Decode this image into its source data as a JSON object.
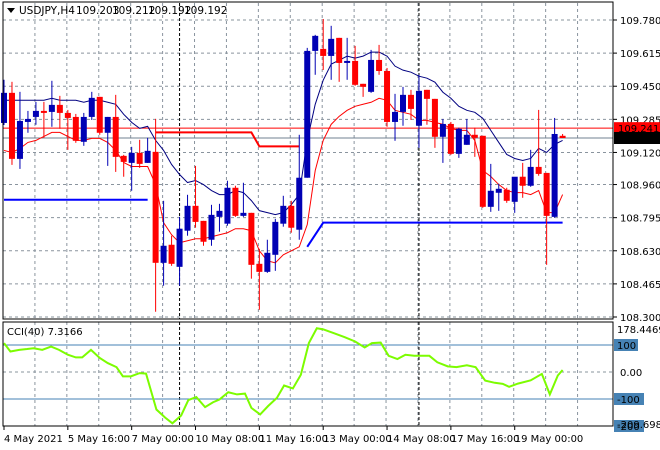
{
  "chart_data": {
    "type": "candlestick",
    "title": {
      "symbol": "USDJPY,H4",
      "open": "109.203",
      "high": "109.212",
      "low": "109.192",
      "close": "109.192"
    },
    "price_axis": {
      "ticks": [
        "109.780",
        "109.615",
        "109.450",
        "109.285",
        "109.120",
        "108.960",
        "108.795",
        "108.630",
        "108.465",
        "108.300"
      ],
      "range": [
        108.3,
        109.78
      ]
    },
    "price_tags": {
      "line_level": "109.241",
      "bid": "109.192"
    },
    "time_labels": [
      "4 May 2021",
      "5 May 16:00",
      "7 May 00:00",
      "10 May 08:00",
      "11 May 16:00",
      "13 May 00:00",
      "14 May 08:00",
      "17 May 16:00",
      "19 May 00:00"
    ],
    "time_label_every_bars": 8,
    "week_separator_bars": [
      22,
      52
    ],
    "candles_ohlc": [
      [
        109.267,
        109.482,
        109.257,
        109.417
      ],
      [
        109.417,
        109.472,
        109.058,
        109.088
      ],
      [
        109.088,
        109.422,
        109.038,
        109.277
      ],
      [
        109.272,
        109.327,
        109.218,
        109.287
      ],
      [
        109.297,
        109.372,
        109.258,
        109.327
      ],
      [
        109.327,
        109.372,
        109.193,
        109.317
      ],
      [
        109.322,
        109.477,
        109.248,
        109.357
      ],
      [
        109.357,
        109.402,
        109.238,
        109.317
      ],
      [
        109.317,
        109.332,
        109.133,
        109.292
      ],
      [
        109.297,
        109.312,
        109.168,
        109.178
      ],
      [
        109.173,
        109.317,
        109.153,
        109.297
      ],
      [
        109.297,
        109.422,
        109.282,
        109.392
      ],
      [
        109.397,
        109.397,
        109.208,
        109.218
      ],
      [
        109.218,
        109.297,
        109.053,
        109.297
      ],
      [
        109.297,
        109.407,
        109.023,
        109.098
      ],
      [
        109.103,
        109.108,
        108.999,
        109.073
      ],
      [
        109.068,
        109.148,
        108.929,
        109.118
      ],
      [
        109.118,
        109.183,
        109.043,
        109.063
      ],
      [
        109.068,
        109.193,
        109.068,
        109.128
      ],
      [
        109.123,
        109.287,
        108.326,
        108.57
      ],
      [
        108.57,
        108.879,
        108.456,
        108.655
      ],
      [
        108.66,
        108.705,
        108.555,
        108.565
      ],
      [
        108.55,
        108.799,
        108.456,
        108.74
      ],
      [
        108.73,
        108.909,
        108.705,
        108.854
      ],
      [
        108.854,
        109.053,
        108.745,
        108.774
      ],
      [
        108.779,
        108.779,
        108.655,
        108.675
      ],
      [
        108.685,
        108.859,
        108.655,
        108.809
      ],
      [
        108.799,
        108.864,
        108.725,
        108.829
      ],
      [
        108.765,
        108.979,
        108.755,
        108.944
      ],
      [
        108.944,
        108.954,
        108.799,
        108.804
      ],
      [
        108.804,
        108.969,
        108.799,
        108.819
      ],
      [
        108.819,
        108.819,
        108.491,
        108.56
      ],
      [
        108.565,
        108.64,
        108.336,
        108.525
      ],
      [
        108.525,
        108.685,
        108.52,
        108.62
      ],
      [
        108.61,
        108.789,
        108.53,
        108.774
      ],
      [
        108.765,
        108.904,
        108.75,
        108.854
      ],
      [
        108.854,
        108.879,
        108.72,
        108.745
      ],
      [
        108.735,
        109.208,
        108.685,
        108.994
      ],
      [
        108.994,
        109.641,
        108.994,
        109.626
      ],
      [
        109.626,
        109.706,
        109.507,
        109.701
      ],
      [
        109.636,
        109.785,
        109.531,
        109.601
      ],
      [
        109.601,
        109.751,
        109.482,
        109.686
      ],
      [
        109.691,
        109.691,
        109.472,
        109.566
      ],
      [
        109.566,
        109.691,
        109.482,
        109.576
      ],
      [
        109.576,
        109.651,
        109.452,
        109.457
      ],
      [
        109.462,
        109.462,
        109.397,
        109.447
      ],
      [
        109.422,
        109.631,
        109.417,
        109.581
      ],
      [
        109.581,
        109.656,
        109.507,
        109.526
      ],
      [
        109.526,
        109.541,
        109.248,
        109.272
      ],
      [
        109.272,
        109.412,
        109.178,
        109.322
      ],
      [
        109.322,
        109.447,
        109.253,
        109.407
      ],
      [
        109.407,
        109.432,
        109.282,
        109.337
      ],
      [
        109.253,
        109.507,
        109.143,
        109.427
      ],
      [
        109.432,
        109.432,
        109.258,
        109.387
      ],
      [
        109.387,
        109.387,
        109.143,
        109.198
      ],
      [
        109.198,
        109.287,
        109.068,
        109.262
      ],
      [
        109.262,
        109.272,
        109.108,
        109.113
      ],
      [
        109.113,
        109.243,
        109.093,
        109.238
      ],
      [
        109.158,
        109.287,
        109.158,
        109.208
      ],
      [
        109.208,
        109.243,
        109.098,
        109.193
      ],
      [
        109.203,
        109.203,
        108.844,
        108.849
      ],
      [
        108.849,
        109.063,
        108.824,
        108.929
      ],
      [
        108.919,
        108.964,
        108.829,
        108.939
      ],
      [
        108.934,
        108.944,
        108.869,
        108.879
      ],
      [
        108.874,
        108.964,
        108.819,
        108.999
      ],
      [
        108.999,
        109.068,
        108.894,
        108.954
      ],
      [
        108.954,
        109.133,
        108.949,
        109.048
      ],
      [
        109.048,
        109.332,
        109.004,
        109.013
      ],
      [
        109.018,
        109.018,
        108.56,
        108.804
      ],
      [
        108.799,
        109.292,
        108.794,
        109.212
      ],
      [
        109.203,
        109.212,
        109.192,
        109.192
      ]
    ],
    "upper_line": [
      109.38,
      109.38,
      109.38,
      109.38,
      109.38,
      109.38,
      109.39,
      109.38,
      109.38,
      109.38,
      109.37,
      109.38,
      109.38,
      109.37,
      109.36,
      109.31,
      109.27,
      109.24,
      109.25,
      109.18,
      109.13,
      109.06,
      109.01,
      108.97,
      108.98,
      108.96,
      108.93,
      108.91,
      108.91,
      108.93,
      108.92,
      108.88,
      108.83,
      108.82,
      108.81,
      108.82,
      108.86,
      108.91,
      109.18,
      109.36,
      109.48,
      109.56,
      109.58,
      109.6,
      109.59,
      109.6,
      109.62,
      109.62,
      109.6,
      109.55,
      109.53,
      109.52,
      109.5,
      109.49,
      109.47,
      109.42,
      109.39,
      109.35,
      109.33,
      109.32,
      109.29,
      109.23,
      109.17,
      109.11,
      109.09,
      109.08,
      109.09,
      109.14,
      109.12,
      109.16,
      109.18
    ],
    "lower_line": [
      109.13,
      109.12,
      109.14,
      109.17,
      109.18,
      109.2,
      109.22,
      109.22,
      109.2,
      109.18,
      109.18,
      109.19,
      109.19,
      109.17,
      109.13,
      109.07,
      109.05,
      109.05,
      109.05,
      108.96,
      108.77,
      108.71,
      108.67,
      108.68,
      108.69,
      108.69,
      108.7,
      108.71,
      108.72,
      108.74,
      108.74,
      108.73,
      108.63,
      108.58,
      108.57,
      108.61,
      108.63,
      108.65,
      108.76,
      109.03,
      109.18,
      109.26,
      109.3,
      109.33,
      109.35,
      109.36,
      109.37,
      109.39,
      109.38,
      109.33,
      109.32,
      109.31,
      109.28,
      109.28,
      109.27,
      109.26,
      109.24,
      109.23,
      109.23,
      109.18,
      109.03,
      109.0,
      108.96,
      108.93,
      108.92,
      108.92,
      108.91,
      108.93,
      108.82,
      108.82,
      108.91
    ],
    "horizontal_line": 109.241,
    "bid_line": 109.192,
    "red_step_line": [
      [
        19,
        109.22
      ],
      [
        31,
        109.22
      ],
      [
        32,
        109.15
      ],
      [
        37,
        109.15
      ]
    ],
    "blue_level_1": [
      [
        0,
        108.884
      ],
      [
        18,
        108.884
      ]
    ],
    "blue_level_2": [
      [
        38,
        108.65
      ],
      [
        40,
        108.77
      ],
      [
        70,
        108.77
      ]
    ],
    "cci": {
      "label": "CCI(40) 7.3166",
      "axis_max": "178.4469",
      "axis_min": "-209.6983",
      "levels": [
        "100",
        "0.00",
        "-100"
      ],
      "bottom_level": "-200",
      "range": [
        -209.6983,
        178.4469
      ],
      "points": [
        [
          0,
          107
        ],
        [
          0.8,
          76
        ],
        [
          1.9,
          82
        ],
        [
          2.9,
          85
        ],
        [
          3.7,
          88
        ],
        [
          4.8,
          82
        ],
        [
          5.9,
          94
        ],
        [
          6.9,
          82
        ],
        [
          8,
          64
        ],
        [
          9,
          54
        ],
        [
          9.8,
          54
        ],
        [
          10.9,
          82
        ],
        [
          12,
          52
        ],
        [
          13,
          33
        ],
        [
          14.1,
          18
        ],
        [
          14.9,
          -16
        ],
        [
          15.9,
          -16
        ],
        [
          17,
          -4
        ],
        [
          17.8,
          -6
        ],
        [
          19.1,
          -139
        ],
        [
          20.2,
          -169
        ],
        [
          21.1,
          -190
        ],
        [
          22.2,
          -161
        ],
        [
          23.1,
          -104
        ],
        [
          24.1,
          -93
        ],
        [
          25.2,
          -130
        ],
        [
          26.2,
          -112
        ],
        [
          27,
          -102
        ],
        [
          28.1,
          -75
        ],
        [
          29.2,
          -83
        ],
        [
          30.2,
          -80
        ],
        [
          31,
          -133
        ],
        [
          32.1,
          -157
        ],
        [
          33.1,
          -126
        ],
        [
          34.2,
          -96
        ],
        [
          35.1,
          -50
        ],
        [
          36.2,
          -61
        ],
        [
          37.2,
          -10
        ],
        [
          38.2,
          107
        ],
        [
          39.2,
          162
        ],
        [
          40,
          158
        ],
        [
          41.3,
          144
        ],
        [
          42.7,
          129
        ],
        [
          44,
          113
        ],
        [
          45.2,
          91
        ],
        [
          46.1,
          107
        ],
        [
          47.2,
          109
        ],
        [
          48.2,
          60
        ],
        [
          49.3,
          48
        ],
        [
          50.3,
          64
        ],
        [
          51.4,
          60
        ],
        [
          53.3,
          60
        ],
        [
          54.3,
          36
        ],
        [
          55.6,
          21
        ],
        [
          56.7,
          18
        ],
        [
          58,
          25
        ],
        [
          59.1,
          18
        ],
        [
          60.3,
          -32
        ],
        [
          61.5,
          -40
        ],
        [
          62.5,
          -44
        ],
        [
          63.3,
          -55
        ],
        [
          64.4,
          -43
        ],
        [
          66,
          -31
        ],
        [
          67.4,
          -7
        ],
        [
          68.4,
          -83
        ],
        [
          69.4,
          -13
        ],
        [
          70,
          7.3166
        ]
      ]
    },
    "colors": {
      "bull": "#0000b4",
      "bear": "#ff0000",
      "upper_line": "#000080",
      "lower_line": "#ff0000",
      "cci": "#7cfc00",
      "grid": "#8a949e",
      "level": "#4682b4",
      "blue_level": "#0000ff"
    }
  }
}
